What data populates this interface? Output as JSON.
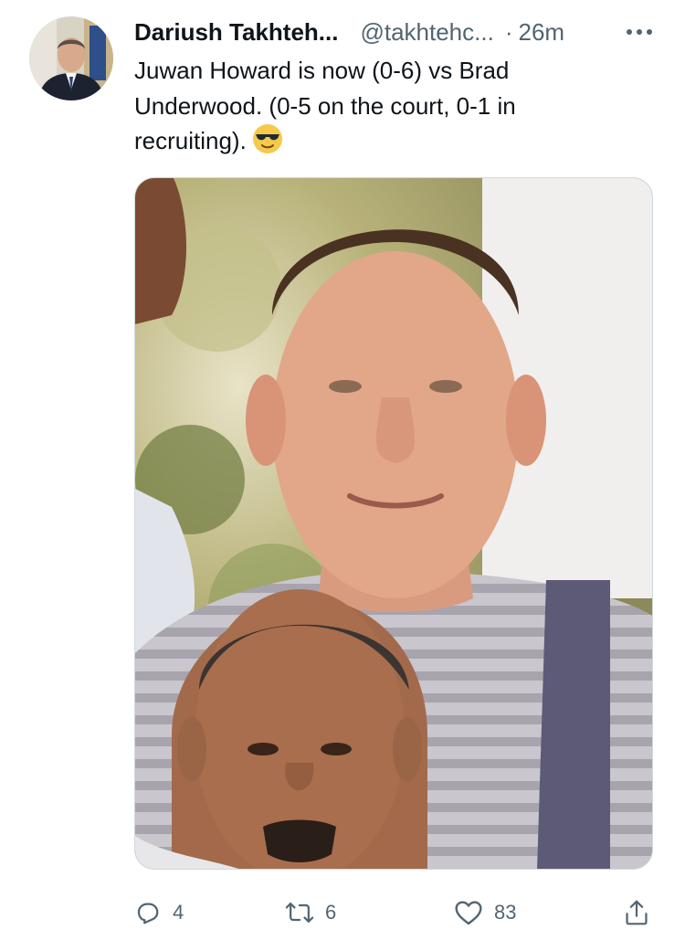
{
  "tweet": {
    "author": {
      "display_name": "Dariush Takhteh...",
      "handle": "@takhtehc...",
      "avatar_icon": "profile-photo"
    },
    "separator": "·",
    "time": "26m",
    "more_icon": "more-horizontal-icon",
    "text_lines": [
      "Juwan Howard is now (0-6) vs Brad",
      "Underwood.  (0-5 on the court, 0-1 in",
      "recruiting)."
    ],
    "emoji": "smiling-face-with-sunglasses",
    "media": {
      "type": "photo",
      "subject": "photo-collage-two-faces"
    },
    "actions": {
      "reply": {
        "icon": "reply-icon",
        "count": "4"
      },
      "retweet": {
        "icon": "retweet-icon",
        "count": "6"
      },
      "like": {
        "icon": "heart-icon",
        "count": "83"
      },
      "share": {
        "icon": "share-icon"
      }
    }
  },
  "colors": {
    "text_primary": "#0f1419",
    "text_secondary": "#536471",
    "border": "#cfd9de"
  }
}
